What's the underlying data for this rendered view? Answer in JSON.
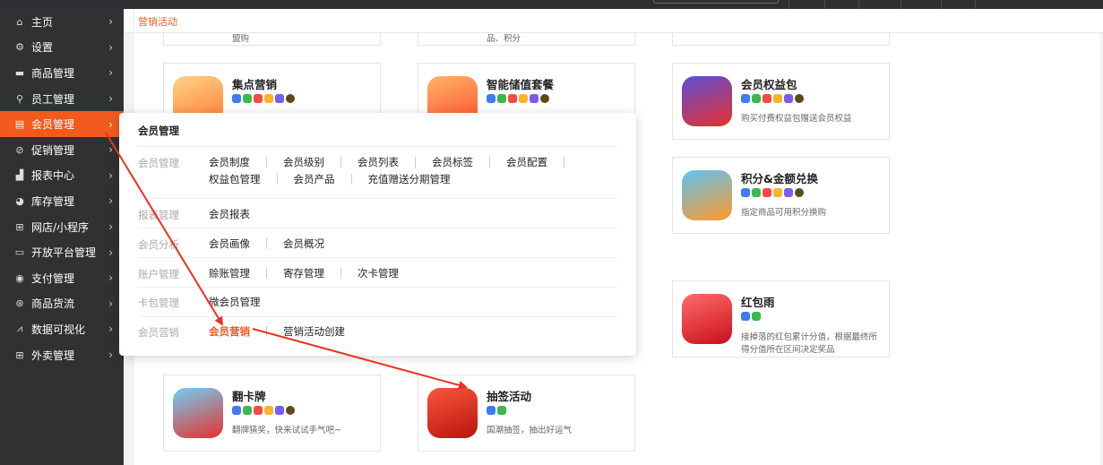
{
  "breadcrumb": "营销活动",
  "sidebar": {
    "items": [
      {
        "label": "主页",
        "icon": "home-icon",
        "glyph": "⌂"
      },
      {
        "label": "设置",
        "icon": "gear-icon",
        "glyph": "⚙"
      },
      {
        "label": "商品管理",
        "icon": "product-icon",
        "glyph": "▬"
      },
      {
        "label": "员工管理",
        "icon": "staff-icon",
        "glyph": "⚲"
      },
      {
        "label": "会员管理",
        "icon": "member-icon",
        "glyph": "▤"
      },
      {
        "label": "促销管理",
        "icon": "promotion-icon",
        "glyph": "⊘"
      },
      {
        "label": "报表中心",
        "icon": "report-icon",
        "glyph": "▟"
      },
      {
        "label": "库存管理",
        "icon": "inventory-icon",
        "glyph": "◕"
      },
      {
        "label": "网店/小程序",
        "icon": "shop-icon",
        "glyph": "⊞"
      },
      {
        "label": "开放平台管理",
        "icon": "monitor-icon",
        "glyph": "▭"
      },
      {
        "label": "支付管理",
        "icon": "payment-icon",
        "glyph": "◉"
      },
      {
        "label": "商品货流",
        "icon": "flow-icon",
        "glyph": "⊛"
      },
      {
        "label": "数据可视化",
        "icon": "chart-icon",
        "glyph": "⩘"
      },
      {
        "label": "外卖管理",
        "icon": "takeout-icon",
        "glyph": "⊞"
      }
    ],
    "arrow": "›"
  },
  "cards": {
    "top1_desc": "盟购",
    "top2_desc": "品、积分",
    "jidian": {
      "title": "集点营销"
    },
    "chuzhi": {
      "title": "智能储值套餐"
    },
    "quanyi": {
      "title": "会员权益包",
      "desc": "购买付费权益包赠送会员权益"
    },
    "jifen": {
      "title": "积分&金额兑换",
      "desc": "指定商品可用积分换购"
    },
    "hongbao": {
      "title": "红包雨",
      "desc1": "接掉落的红包累计分值，根据最终所",
      "desc2": "得分值所在区间决定奖品"
    },
    "fanka": {
      "title": "翻卡牌",
      "desc": "翻牌猜奖，快来试试手气吧~"
    },
    "chouqian": {
      "title": "抽签活动",
      "desc": "国潮抽签，抽出好运气"
    }
  },
  "dropdown": {
    "title": "会员管理",
    "rows": [
      {
        "cat": "会员管理",
        "links": [
          "会员制度",
          "会员级别",
          "会员列表",
          "会员标签",
          "会员配置",
          "权益包管理",
          "会员产品",
          "充值赠送分期管理"
        ]
      },
      {
        "cat": "报表管理",
        "links": [
          "会员报表"
        ]
      },
      {
        "cat": "会员分析",
        "links": [
          "会员画像",
          "会员概况"
        ]
      },
      {
        "cat": "账户管理",
        "links": [
          "赊账管理",
          "寄存管理",
          "次卡管理"
        ]
      },
      {
        "cat": "卡包管理",
        "links": [
          "微会员管理"
        ]
      },
      {
        "cat": "会员营销",
        "links": [
          "会员营销",
          "营销活动创建"
        ]
      }
    ]
  },
  "colors": {
    "accent": "#f25a1e",
    "sidebar": "#303133",
    "arrow": "#e8321e"
  }
}
